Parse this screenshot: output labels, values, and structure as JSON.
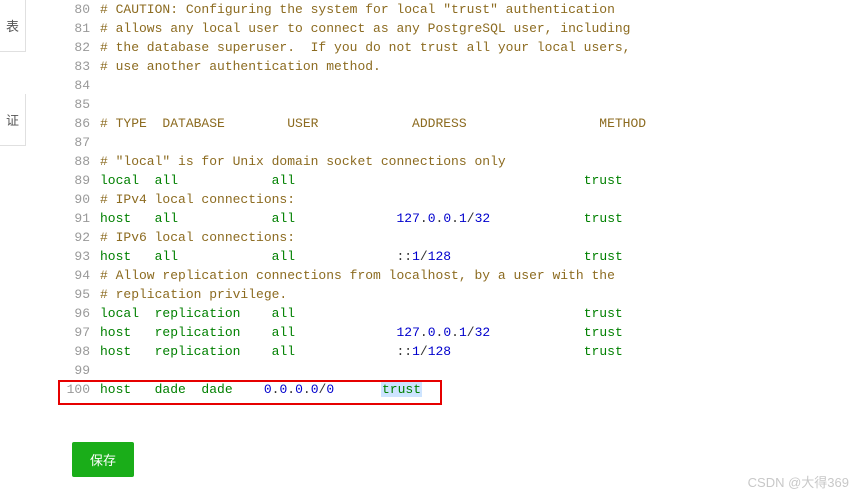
{
  "side": {
    "top": "表",
    "mid": "证"
  },
  "lines": [
    {
      "n": 80,
      "t": "cmt",
      "txt": "# CAUTION: Configuring the system for local \"trust\" authentication"
    },
    {
      "n": 81,
      "t": "cmt",
      "txt": "# allows any local user to connect as any PostgreSQL user, including"
    },
    {
      "n": 82,
      "t": "cmt",
      "txt": "# the database superuser.  If you do not trust all your local users,"
    },
    {
      "n": 83,
      "t": "cmt",
      "txt": "# use another authentication method."
    },
    {
      "n": 84,
      "t": "blank",
      "txt": ""
    },
    {
      "n": 85,
      "t": "blank",
      "txt": ""
    },
    {
      "n": 86,
      "t": "cmt",
      "txt": "# TYPE  DATABASE        USER            ADDRESS                 METHOD"
    },
    {
      "n": 87,
      "t": "blank",
      "txt": ""
    },
    {
      "n": 88,
      "t": "cmt",
      "txt": "# \"local\" is for Unix domain socket connections only"
    },
    {
      "n": 89,
      "t": "rule",
      "p": {
        "type": "local  ",
        "db": "all            ",
        "user": "all",
        "pad1": "                                     ",
        "addr": "",
        "pad2": "",
        "method": "trust"
      }
    },
    {
      "n": 90,
      "t": "cmt",
      "txt": "# IPv4 local connections:"
    },
    {
      "n": 91,
      "t": "rule",
      "p": {
        "type": "host   ",
        "db": "all            ",
        "user": "all",
        "pad1": "             ",
        "addr": "127.0.0.1/32",
        "pad2": "            ",
        "method": "trust"
      }
    },
    {
      "n": 92,
      "t": "cmt",
      "txt": "# IPv6 local connections:"
    },
    {
      "n": 93,
      "t": "rule",
      "p": {
        "type": "host   ",
        "db": "all            ",
        "user": "all",
        "pad1": "             ",
        "addr": "::1/128",
        "pad2": "                 ",
        "method": "trust"
      }
    },
    {
      "n": 94,
      "t": "cmt",
      "txt": "# Allow replication connections from localhost, by a user with the"
    },
    {
      "n": 95,
      "t": "cmt",
      "txt": "# replication privilege."
    },
    {
      "n": 96,
      "t": "rule",
      "p": {
        "type": "local  ",
        "db": "replication    ",
        "user": "all",
        "pad1": "                                     ",
        "addr": "",
        "pad2": "",
        "method": "trust"
      }
    },
    {
      "n": 97,
      "t": "rule",
      "p": {
        "type": "host   ",
        "db": "replication    ",
        "user": "all",
        "pad1": "             ",
        "addr": "127.0.0.1/32",
        "pad2": "            ",
        "method": "trust"
      }
    },
    {
      "n": 98,
      "t": "rule",
      "p": {
        "type": "host   ",
        "db": "replication    ",
        "user": "all",
        "pad1": "             ",
        "addr": "::1/128",
        "pad2": "                 ",
        "method": "trust"
      }
    },
    {
      "n": 99,
      "t": "blank",
      "txt": ""
    },
    {
      "n": 100,
      "t": "rule-hl",
      "p": {
        "type": "host   ",
        "db": "dade  ",
        "user": "dade",
        "pad1": "    ",
        "addr": "0.0.0.0/0",
        "pad2": "      ",
        "method": "trust"
      }
    }
  ],
  "button": {
    "save": "保存"
  },
  "watermark": "CSDN @大得369"
}
